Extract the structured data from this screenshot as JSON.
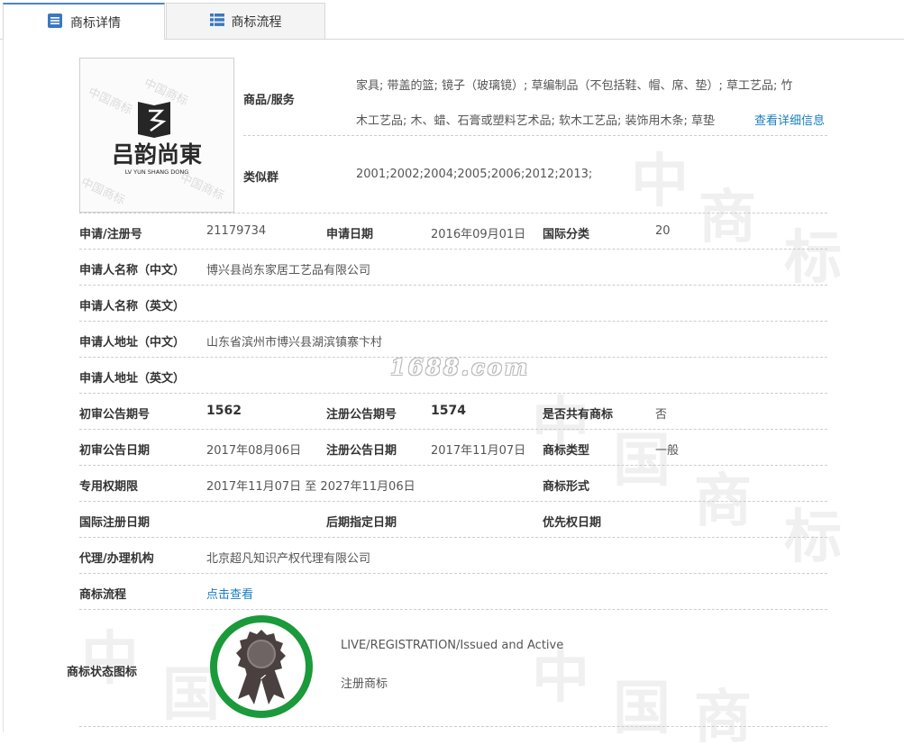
{
  "tabs": [
    {
      "label": "商标详情",
      "icon": "document-list-icon",
      "active": true
    },
    {
      "label": "商标流程",
      "icon": "grid-list-icon",
      "active": false
    }
  ],
  "logo": {
    "icon": "trademark-logo-image",
    "brand_cn": "吕韵尚東",
    "brand_en": "LV YUN SHANG DONG",
    "watermark": "中国商标"
  },
  "goods": {
    "label": "商品/服务",
    "line1": "家具; 带盖的篮; 镜子（玻璃镜）; 草编制品（不包括鞋、帽、席、垫）; 草工艺品; 竹",
    "line2": "木工艺品; 木、蜡、石膏或塑料艺术品; 软木工艺品; 装饰用木条; 草垫",
    "more_link": "查看详细信息"
  },
  "similar_group": {
    "label": "类似群",
    "value": "2001;2002;2004;2005;2006;2012;2013;"
  },
  "rows": {
    "reg_no": {
      "label": "申请/注册号",
      "value": "21179734"
    },
    "apply_date": {
      "label": "申请日期",
      "value": "2016年09月01日"
    },
    "intl_class": {
      "label": "国际分类",
      "value": "20"
    },
    "applicant_cn": {
      "label": "申请人名称（中文）",
      "value": "博兴县尚东家居工艺品有限公司"
    },
    "applicant_en": {
      "label": "申请人名称（英文）",
      "value": ""
    },
    "address_cn": {
      "label": "申请人地址（中文）",
      "value": "山东省滨州市博兴县湖滨镇寨卞村"
    },
    "address_en": {
      "label": "申请人地址（英文）",
      "value": ""
    },
    "prelim_pub_no": {
      "label": "初审公告期号",
      "value": "1562"
    },
    "reg_pub_no": {
      "label": "注册公告期号",
      "value": "1574"
    },
    "shared": {
      "label": "是否共有商标",
      "value": "否"
    },
    "prelim_pub_date": {
      "label": "初审公告日期",
      "value": "2017年08月06日"
    },
    "reg_pub_date": {
      "label": "注册公告日期",
      "value": "2017年11月07日"
    },
    "tm_type": {
      "label": "商标类型",
      "value": "一般"
    },
    "exclusive_period": {
      "label": "专用权期限",
      "value": "2017年11月07日 至 2027年11月06日"
    },
    "tm_form": {
      "label": "商标形式",
      "value": ""
    },
    "intl_reg_date": {
      "label": "国际注册日期",
      "value": ""
    },
    "later_date": {
      "label": "后期指定日期",
      "value": ""
    },
    "priority_date": {
      "label": "优先权日期",
      "value": ""
    },
    "agent": {
      "label": "代理/办理机构",
      "value": "北京超凡知识产权代理有限公司"
    },
    "flow": {
      "label": "商标流程",
      "value": "点击查看"
    }
  },
  "status": {
    "label": "商标状态图标",
    "line1": "LIVE/REGISTRATION/Issued and Active",
    "line2": "注册商标",
    "icon": "award-ribbon-icon",
    "ring_color": "#1a9a3a"
  },
  "site_watermark": "1688.com",
  "bg_watermark_chars": [
    "中",
    "国",
    "商",
    "标"
  ],
  "colors": {
    "accent": "#4a86c8",
    "link": "#1a7fc1",
    "status_ring": "#1a9a3a"
  }
}
